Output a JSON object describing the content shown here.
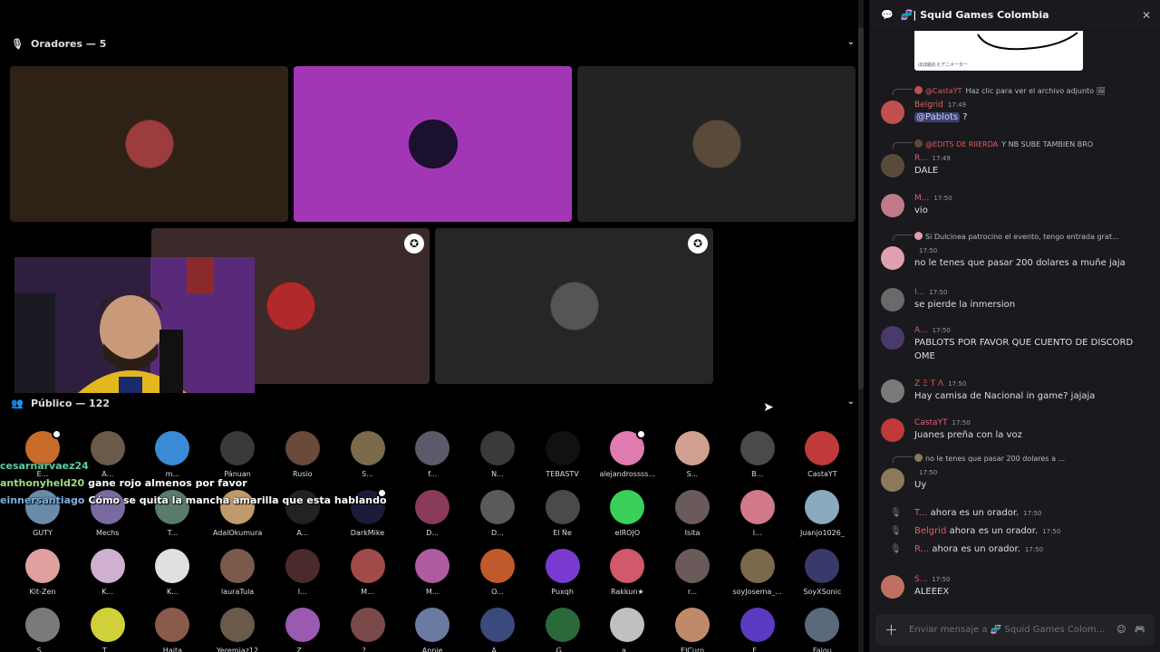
{
  "speakers_header": {
    "icon": "microphone-icon",
    "label": "Oradores — 5"
  },
  "audience_header": {
    "icon": "people-icon",
    "label": "Público — 122"
  },
  "speaker_tiles": [
    {
      "bg": "#2e2116",
      "avatar": "#9c3c3c",
      "badge": false
    },
    {
      "bg": "#a237b5",
      "avatar": "#1b1030",
      "badge": false
    },
    {
      "bg": "#232323",
      "avatar": "#5a4a3a",
      "badge": false
    },
    {
      "bg": "#3a2a2a",
      "avatar": "#b02a2a",
      "badge": true
    },
    {
      "bg": "#262626",
      "avatar": "#555555",
      "badge": true
    }
  ],
  "audience": [
    {
      "name": "E...",
      "color": "#c86a2a",
      "sub": true
    },
    {
      "name": "A...",
      "color": "#6b5a4a",
      "sub": false
    },
    {
      "name": "m...",
      "color": "#3a8ad6",
      "sub": false
    },
    {
      "name": "Pánuan",
      "color": "#3a3a3a",
      "sub": false
    },
    {
      "name": "Rusio",
      "color": "#6a4a3a",
      "sub": false
    },
    {
      "name": "S...",
      "color": "#7a6a4a",
      "sub": false
    },
    {
      "name": "f...",
      "color": "#5a5a6a",
      "sub": false
    },
    {
      "name": "N...",
      "color": "#3a3a3a",
      "sub": false
    },
    {
      "name": "TEBASTV",
      "color": "#111111",
      "sub": false
    },
    {
      "name": "alejandrossss...",
      "color": "#e07ab0",
      "sub": true
    },
    {
      "name": "S...",
      "color": "#d0a090",
      "sub": false
    },
    {
      "name": "B...",
      "color": "#4a4a4a",
      "sub": false
    },
    {
      "name": "CastaYT",
      "color": "#c03a3a",
      "sub": false
    },
    {
      "name": "GUTY",
      "color": "#6a8aaa",
      "sub": false
    },
    {
      "name": "Mechs",
      "color": "#7a6aa0",
      "sub": false
    },
    {
      "name": "T...",
      "color": "#5a7a6a",
      "sub": false
    },
    {
      "name": "AdalOkumura",
      "color": "#c09a6a",
      "sub": false
    },
    {
      "name": "A...",
      "color": "#222222",
      "sub": false
    },
    {
      "name": "DarkMike",
      "color": "#1a1a3a",
      "sub": true
    },
    {
      "name": "D...",
      "color": "#8a3a5a",
      "sub": false
    },
    {
      "name": "D...",
      "color": "#5a5a5a",
      "sub": false
    },
    {
      "name": "El Ñe",
      "color": "#4a4a4a",
      "sub": false
    },
    {
      "name": "elROJO",
      "color": "#3ad05a",
      "sub": false
    },
    {
      "name": "Isita",
      "color": "#6a5a5a",
      "sub": false
    },
    {
      "name": "I...",
      "color": "#d07a8a",
      "sub": false
    },
    {
      "name": "Juanjo1026_",
      "color": "#8aaac0",
      "sub": false
    },
    {
      "name": "Kit-Zen",
      "color": "#e0a0a0",
      "sub": false
    },
    {
      "name": "K...",
      "color": "#d0b0d0",
      "sub": false
    },
    {
      "name": "K...",
      "color": "#e0e0e0",
      "sub": false
    },
    {
      "name": "lauraTula",
      "color": "#7a5a4a",
      "sub": false
    },
    {
      "name": "I...",
      "color": "#4a2a2a",
      "sub": false
    },
    {
      "name": "M...",
      "color": "#a04a4a",
      "sub": false
    },
    {
      "name": "M...",
      "color": "#b05aa0",
      "sub": false
    },
    {
      "name": "O...",
      "color": "#c05a2a",
      "sub": false
    },
    {
      "name": "Puxqh",
      "color": "#7a3ad0",
      "sub": false
    },
    {
      "name": "Rakkun★",
      "color": "#d05a6a",
      "sub": false
    },
    {
      "name": "r...",
      "color": "#6a5a5a",
      "sub": false
    },
    {
      "name": "soyJosema_...",
      "color": "#7a6a4a",
      "sub": false
    },
    {
      "name": "SoyXSonic",
      "color": "#3a3a6a",
      "sub": false
    },
    {
      "name": "S...",
      "color": "#7a7a7a",
      "sub": false
    },
    {
      "name": "T...",
      "color": "#d0d03a",
      "sub": false
    },
    {
      "name": "Haita",
      "color": "#8a5a4a",
      "sub": false
    },
    {
      "name": "Yeremiaz12",
      "color": "#6a5a4a",
      "sub": false
    },
    {
      "name": "Z...",
      "color": "#9a5ab0",
      "sub": false
    },
    {
      "name": "?...",
      "color": "#7a4a4a",
      "sub": false
    },
    {
      "name": "Annie",
      "color": "#6a7aa0",
      "sub": false
    },
    {
      "name": "A...",
      "color": "#3a4a7a",
      "sub": false
    },
    {
      "name": "G...",
      "color": "#2a6a3a",
      "sub": false
    },
    {
      "name": "a...",
      "color": "#c0c0c0",
      "sub": false
    },
    {
      "name": "ElCuro",
      "color": "#c08a6a",
      "sub": false
    },
    {
      "name": "F...",
      "color": "#5a3ac0",
      "sub": false
    },
    {
      "name": "Falou",
      "color": "#5a6a7a",
      "sub": false
    }
  ],
  "chat_overlay": [
    {
      "user": "cesarnarvaez24",
      "text": "",
      "color": "#5ad0a0"
    },
    {
      "user": "anthonyheld20",
      "text": "gane rojo almenos por favor",
      "color": "#9ae07a"
    },
    {
      "user": "einnersantiago",
      "text": "Cómo se quita la mancha amarilla que esta hablando",
      "color": "#7ab0e0"
    }
  ],
  "chat": {
    "title": "🧬| Squid Games Colombia",
    "header_icon": "thread-icon",
    "close_icon": "close-icon",
    "image_caption": "ほほ絵おえアニメーター",
    "messages": [
      {
        "reply_name": "@CastaYT",
        "reply_text": "Haz clic para ver el archivo adjunto 🖼",
        "reply_color": "#d0606a",
        "author": "Belgrid",
        "author_color": "#e0605a",
        "time": "17:49",
        "mention": "@Pablots",
        "text": " ?",
        "avatar": "#c05050"
      },
      {
        "reply_name": "@EDITS DE RIIERDA",
        "reply_text": "Y NB SUBE TAMBIEN BRO",
        "reply_color": "#e05a5a",
        "author": "R...",
        "author_color": "#d05a6a",
        "time": "17:49",
        "mention": "",
        "text": "DALE",
        "avatar": "#5a4a3a"
      },
      {
        "reply_name": "",
        "reply_text": "",
        "reply_color": "",
        "author": "M...",
        "author_color": "#d05a9a",
        "time": "17:50",
        "mention": "",
        "text": "vio",
        "avatar": "#c07a8a"
      },
      {
        "reply_name": "",
        "reply_text": "Si Dulcinea patrocino el evento, tengo entrada grat...",
        "reply_color": "#5a6ae0",
        "author": "",
        "author_color": "#5a6ae0",
        "time": "17:50",
        "mention": "",
        "text": "no le tenes que pasar 200 dolares a muñe jaja",
        "avatar": "#e0a0b0"
      },
      {
        "reply_name": "",
        "reply_text": "",
        "reply_color": "",
        "author": "I...",
        "author_color": "#d05a6a",
        "time": "17:50",
        "mention": "",
        "text": "se pierde la inmersion",
        "avatar": "#6a6a6a"
      },
      {
        "reply_name": "",
        "reply_text": "",
        "reply_color": "",
        "author": "A...",
        "author_color": "#d05a6a",
        "time": "17:50",
        "mention": "",
        "text": "PABLOTS POR FAVOR QUE CUENTO DE DISCORD OME",
        "avatar": "#4a3a6a"
      },
      {
        "reply_name": "",
        "reply_text": "",
        "reply_color": "",
        "author": "Z Ξ T Λ",
        "author_color": "#e05a5a",
        "time": "17:50",
        "mention": "",
        "text": "Hay camisa de Nacional in game? jajaja",
        "avatar": "#7a7a7a"
      },
      {
        "reply_name": "",
        "reply_text": "",
        "reply_color": "",
        "author": "CastaYT",
        "author_color": "#e05a7a",
        "time": "17:50",
        "mention": "",
        "text": "Juanes preña con la voz",
        "avatar": "#c03a3a"
      },
      {
        "reply_name": "",
        "reply_text": "no le tenes que pasar 200 dolares a ...",
        "reply_color": "#5a6ae0",
        "author": "",
        "author_color": "#5a6ae0",
        "time": "17:50",
        "mention": "",
        "text": "Uy",
        "avatar": "#8a7a5a"
      },
      {
        "reply_name": "",
        "reply_text": "",
        "reply_color": "",
        "author": "S...",
        "author_color": "#d05a6a",
        "time": "17:50",
        "mention": "",
        "text": "ALEEEX",
        "avatar": "#c07060"
      }
    ],
    "system": [
      {
        "name": "T...",
        "name_color": "#d05a6a",
        "text": "ahora es un orador.",
        "time": "17:50"
      },
      {
        "name": "Belgrid",
        "name_color": "#e0605a",
        "text": "ahora es un orador.",
        "time": "17:50"
      },
      {
        "name": "R...",
        "name_color": "#d05a6a",
        "text": "ahora es un orador.",
        "time": "17:50"
      }
    ],
    "composer_placeholder": "Enviar mensaje a 🧬 Squid Games Colom...",
    "composer_icons": [
      "plus-icon",
      "emoji-icon",
      "gamepad-icon"
    ]
  }
}
